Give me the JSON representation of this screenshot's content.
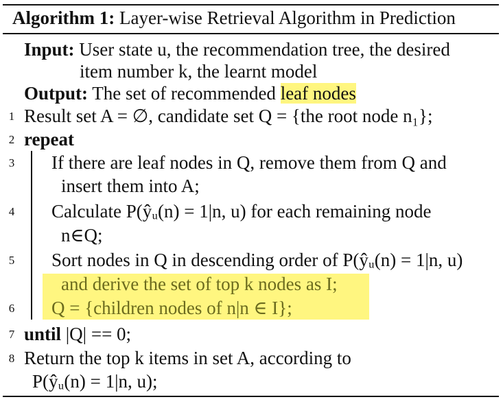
{
  "algorithm": {
    "label": "Algorithm 1:",
    "title": "Layer-wise Retrieval Algorithm in Prediction"
  },
  "input": {
    "label": "Input:",
    "line1": "User state u, the recommendation tree, the desired",
    "line2": "item number k, the learnt model"
  },
  "output": {
    "label": "Output:",
    "text": "The set of recommended",
    "highlight": "leaf nodes"
  },
  "steps": [
    {
      "num": "1",
      "text": "Result set A = ∅, candidate set Q = {the root node n₁};"
    },
    {
      "num": "2",
      "keyword": "repeat"
    },
    {
      "num": "3",
      "line1": "If there are leaf nodes in Q, remove them from Q and",
      "line2": "insert them into A;"
    },
    {
      "num": "4",
      "line1": "Calculate P(ŷᵤ(n) = 1|n, u) for each remaining node",
      "line2": "n∈Q;"
    },
    {
      "num": "5",
      "line1": "Sort nodes in Q in descending order of P(ŷᵤ(n) = 1|n, u)",
      "line2": "and derive the set of top k nodes as I;"
    },
    {
      "num": "6",
      "text": "Q = {children nodes of n|n ∈ I};"
    },
    {
      "num": "7",
      "keyword": "until",
      "text": "|Q| == 0;"
    },
    {
      "num": "8",
      "line1": "Return the top k items in set A, according to",
      "line2": "P(ŷᵤ(n) = 1|n, u);"
    }
  ],
  "colors": {
    "highlight": "#fff680",
    "highlight_text": "#6b6b1e",
    "text": "#111111"
  }
}
